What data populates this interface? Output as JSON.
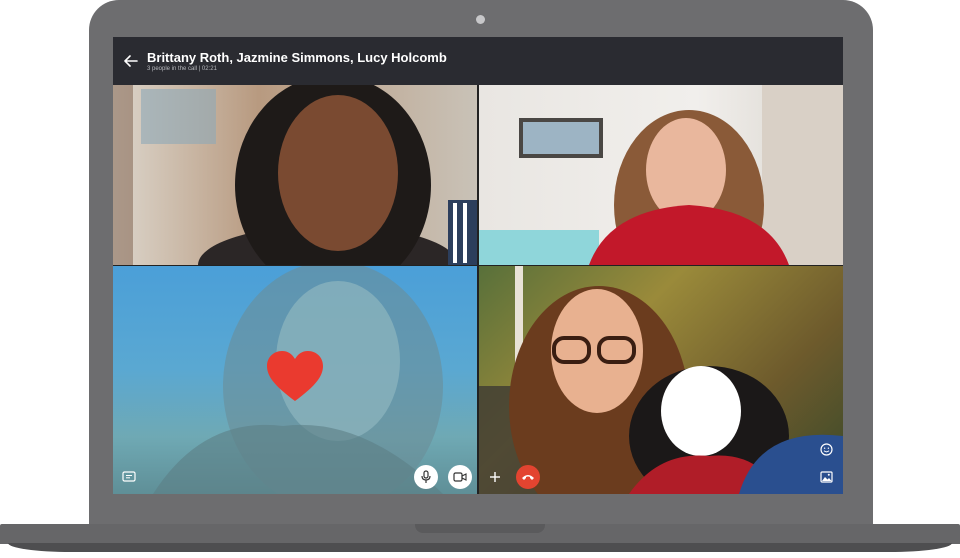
{
  "call": {
    "title": "Brittany Roth, Jazmine Simmons, Lucy Holcomb",
    "status": "3 people in the call | 02:21"
  },
  "participants": [
    {
      "tile": 1,
      "reaction": ""
    },
    {
      "tile": 2,
      "reaction": ""
    },
    {
      "tile": 3,
      "reaction": "heart"
    },
    {
      "tile": 4,
      "reaction": ""
    }
  ],
  "controls": {
    "icons": [
      "back-arrow-icon",
      "chat-icon",
      "microphone-icon",
      "video-camera-icon",
      "plus-icon",
      "end-call-icon",
      "emoji-icon",
      "image-icon"
    ]
  },
  "colors": {
    "header_bg": "#2a2b31",
    "end_call": "#e34430",
    "heart": "#ea3a2f"
  }
}
